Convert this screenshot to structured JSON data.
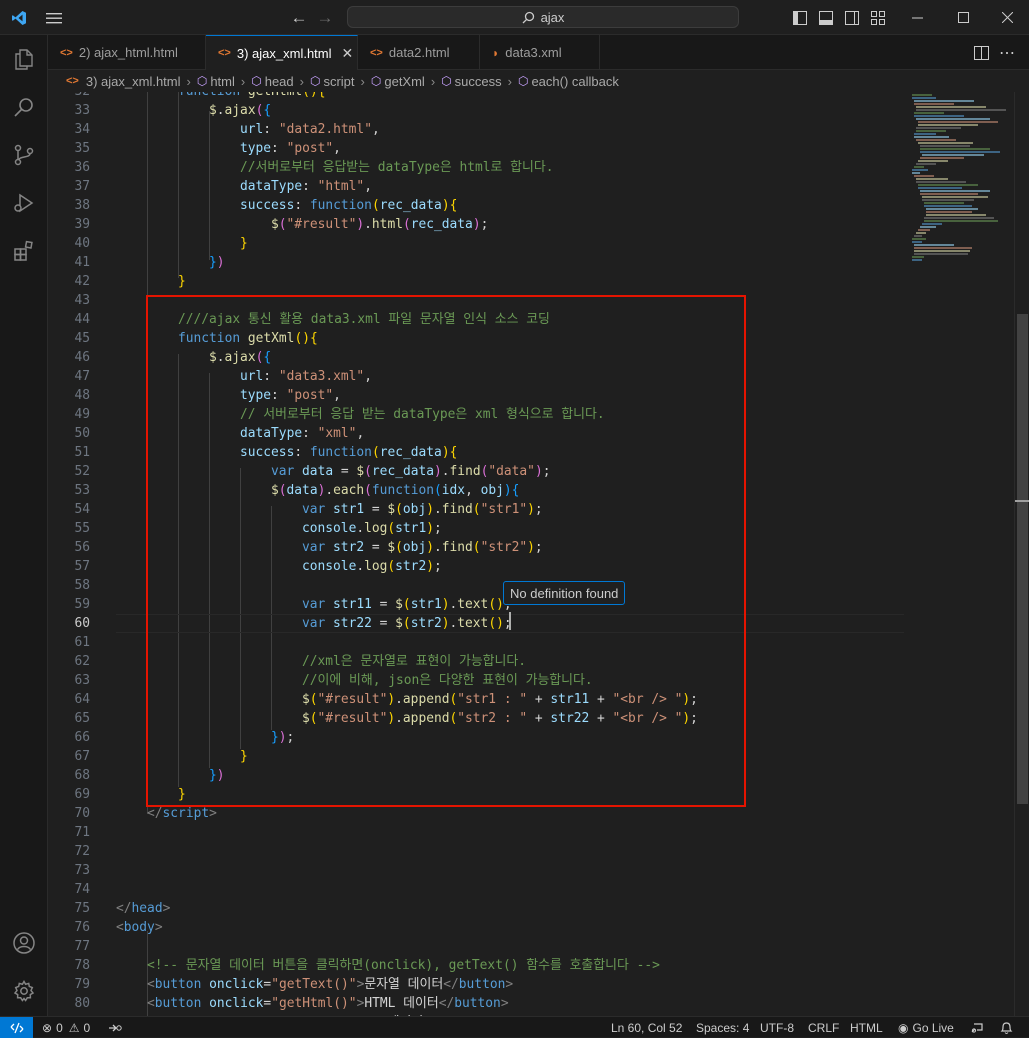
{
  "titlebar": {
    "search_text": "ajax"
  },
  "tabs": [
    {
      "label": "2) ajax_html.html",
      "active": false
    },
    {
      "label": "3) ajax_xml.html",
      "active": true
    },
    {
      "label": "data2.html",
      "active": false
    },
    {
      "label": "data3.xml",
      "active": false
    }
  ],
  "breadcrumb": [
    "3) ajax_xml.html",
    "html",
    "head",
    "script",
    "getXml",
    "success",
    "each() callback"
  ],
  "editor": {
    "tooltip": "No definition found",
    "current_line": 60
  },
  "statusbar": {
    "errors": "0",
    "warnings": "0",
    "position": "Ln 60, Col 52",
    "spaces": "Spaces: 4",
    "encoding": "UTF-8",
    "eol": "CRLF",
    "language": "HTML",
    "golive": "Go Live"
  },
  "colors": {
    "accent": "#0078d4",
    "highlight_box": "#e51400"
  }
}
